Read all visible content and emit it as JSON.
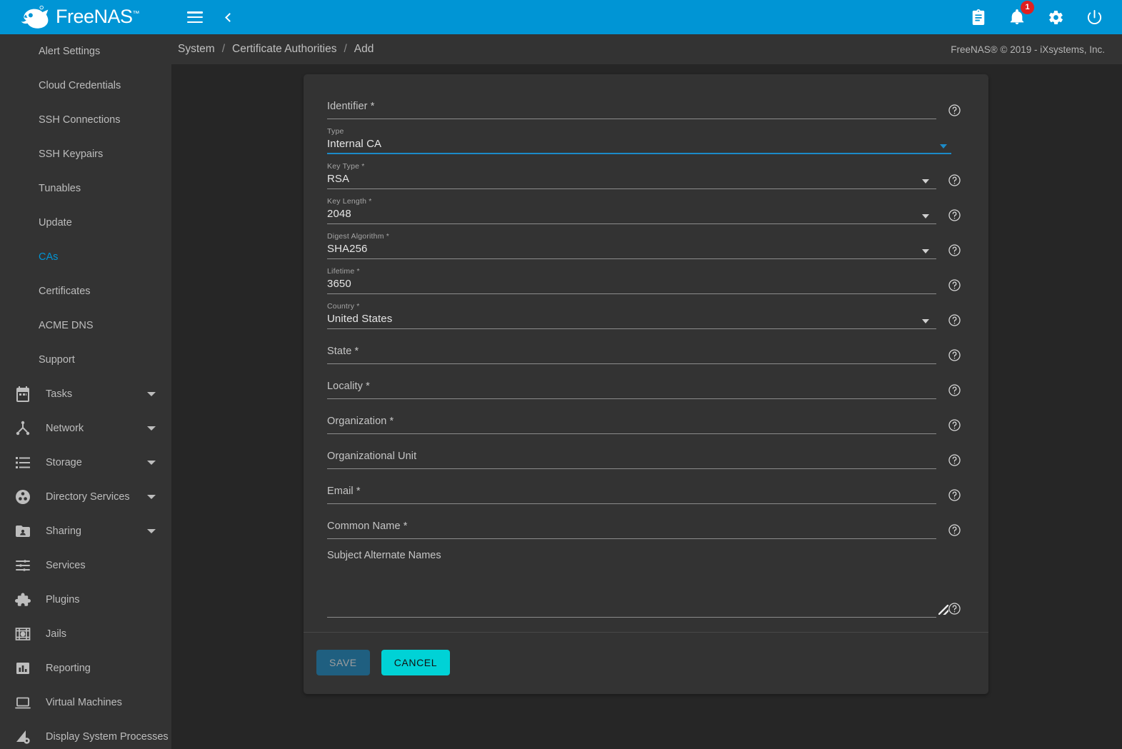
{
  "app": {
    "brand": "FreeNAS",
    "brand_tm": "™",
    "header_color": "#0095d5",
    "accent_color": "#0095d5",
    "cancel_color": "#00d2d6"
  },
  "topbar": {
    "menu_icon": "hamburger-menu-icon",
    "back_icon": "chevron-left-icon",
    "icons": [
      {
        "name": "clipboard-icon",
        "label": "Tasks / Jobs"
      },
      {
        "name": "notifications-bell-icon",
        "label": "Alerts",
        "badge": "1"
      },
      {
        "name": "gear-icon",
        "label": "Settings"
      },
      {
        "name": "power-icon",
        "label": "Power"
      }
    ]
  },
  "sidebar": {
    "sub_items": [
      {
        "label": "Alert Settings",
        "active": false
      },
      {
        "label": "Cloud Credentials",
        "active": false
      },
      {
        "label": "SSH Connections",
        "active": false
      },
      {
        "label": "SSH Keypairs",
        "active": false
      },
      {
        "label": "Tunables",
        "active": false
      },
      {
        "label": "Update",
        "active": false
      },
      {
        "label": "CAs",
        "active": true
      },
      {
        "label": "Certificates",
        "active": false
      },
      {
        "label": "ACME DNS",
        "active": false
      },
      {
        "label": "Support",
        "active": false
      }
    ],
    "items": [
      {
        "label": "Tasks",
        "icon": "calendar-icon",
        "expandable": true
      },
      {
        "label": "Network",
        "icon": "network-icon",
        "expandable": true
      },
      {
        "label": "Storage",
        "icon": "storage-list-icon",
        "expandable": true
      },
      {
        "label": "Directory Services",
        "icon": "directory-services-icon",
        "expandable": true
      },
      {
        "label": "Sharing",
        "icon": "shared-folder-icon",
        "expandable": true
      },
      {
        "label": "Services",
        "icon": "sliders-icon",
        "expandable": false
      },
      {
        "label": "Plugins",
        "icon": "puzzle-piece-icon",
        "expandable": false
      },
      {
        "label": "Jails",
        "icon": "jail-bars-icon",
        "expandable": false
      },
      {
        "label": "Reporting",
        "icon": "bar-chart-icon",
        "expandable": false
      },
      {
        "label": "Virtual Machines",
        "icon": "laptop-icon",
        "expandable": false
      },
      {
        "label": "Display System Processes",
        "icon": "processes-icon",
        "expandable": false
      }
    ]
  },
  "breadcrumb": {
    "items": [
      "System",
      "Certificate Authorities",
      "Add"
    ],
    "separator": "/",
    "copyright": "FreeNAS® © 2019 - iXsystems, Inc."
  },
  "form": {
    "fields": [
      {
        "label": "Identifier *",
        "value": "",
        "kind": "text",
        "help": true,
        "focused": false
      },
      {
        "label": "Type",
        "value": "Internal CA",
        "kind": "select",
        "help": false,
        "focused": true
      },
      {
        "label": "Key Type *",
        "value": "RSA",
        "kind": "select",
        "help": true,
        "focused": false
      },
      {
        "label": "Key Length *",
        "value": "2048",
        "kind": "select",
        "help": true,
        "focused": false
      },
      {
        "label": "Digest Algorithm *",
        "value": "SHA256",
        "kind": "select",
        "help": true,
        "focused": false
      },
      {
        "label": "Lifetime *",
        "value": "3650",
        "kind": "text",
        "help": true,
        "focused": false
      },
      {
        "label": "Country *",
        "value": "United States",
        "kind": "select",
        "help": true,
        "focused": false
      },
      {
        "label": "State *",
        "value": "",
        "kind": "text",
        "help": true,
        "focused": false
      },
      {
        "label": "Locality *",
        "value": "",
        "kind": "text",
        "help": true,
        "focused": false
      },
      {
        "label": "Organization *",
        "value": "",
        "kind": "text",
        "help": true,
        "focused": false
      },
      {
        "label": "Organizational Unit",
        "value": "",
        "kind": "text",
        "help": true,
        "focused": false
      },
      {
        "label": "Email *",
        "value": "",
        "kind": "text",
        "help": true,
        "focused": false
      },
      {
        "label": "Common Name *",
        "value": "",
        "kind": "text",
        "help": true,
        "focused": false
      }
    ],
    "textarea": {
      "label": "Subject Alternate Names",
      "value": "",
      "help": true
    },
    "help_icon": "help-circle-icon",
    "dropdown_icon": "caret-down-icon",
    "resize_icon": "resize-grip-icon"
  },
  "buttons": {
    "save": "SAVE",
    "save_disabled": true,
    "cancel": "CANCEL"
  }
}
